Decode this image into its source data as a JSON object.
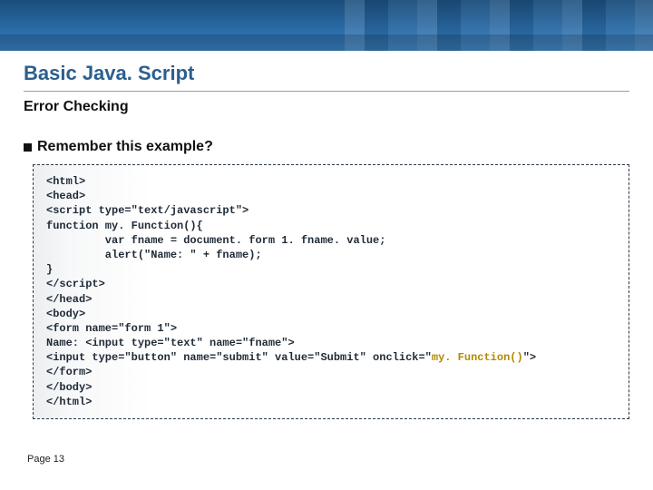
{
  "header": {
    "title": "Basic Java. Script",
    "subtitle": "Error Checking"
  },
  "bullet": {
    "text": "Remember this example?"
  },
  "code": {
    "l1": "<html>",
    "l2": "<head>",
    "l3": "<script type=\"text/javascript\">",
    "l4": "function my. Function(){",
    "l5": "         var fname = document. form 1. fname. value;",
    "l6": "         alert(\"Name: \" + fname);",
    "l7": "}",
    "l8": "</script>",
    "l9": "</head>",
    "l10": "<body>",
    "l11": "<form name=\"form 1\">",
    "l12": "Name: <input type=\"text\" name=\"fname\">",
    "l13a": "<input type=\"button\" name=\"submit\" value=\"Submit\" onclick=\"",
    "l13b": "my. Function()",
    "l13c": "\">",
    "l14": "</form>",
    "l15": "</body>",
    "l16": "</html>"
  },
  "footer": {
    "page": "Page 13"
  }
}
